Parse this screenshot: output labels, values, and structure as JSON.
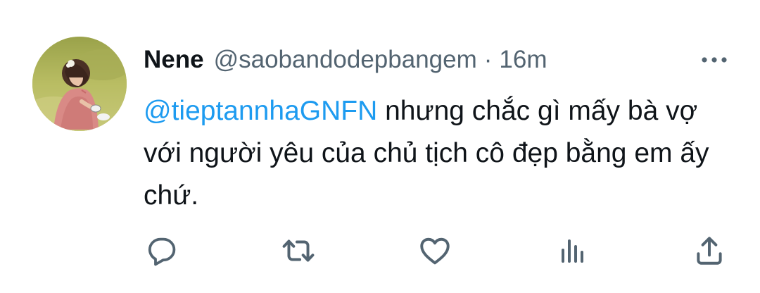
{
  "tweet": {
    "author_name": "Nene",
    "author_handle": "@saobandodepbangem",
    "separator": "·",
    "time": "16m",
    "mention": "@tieptannhaGNFN",
    "body": " nhưng chắc gì mấy bà vợ với người yêu của chủ tịch cô đẹp bằng em ấy chứ."
  },
  "icons": {
    "more": "more-horizontal-icon",
    "reply": "reply-icon",
    "retweet": "retweet-icon",
    "like": "heart-icon",
    "analytics": "analytics-icon",
    "share": "share-icon"
  },
  "colors": {
    "text": "#0f1419",
    "secondary": "#536471",
    "accent": "#1d9bf0"
  }
}
